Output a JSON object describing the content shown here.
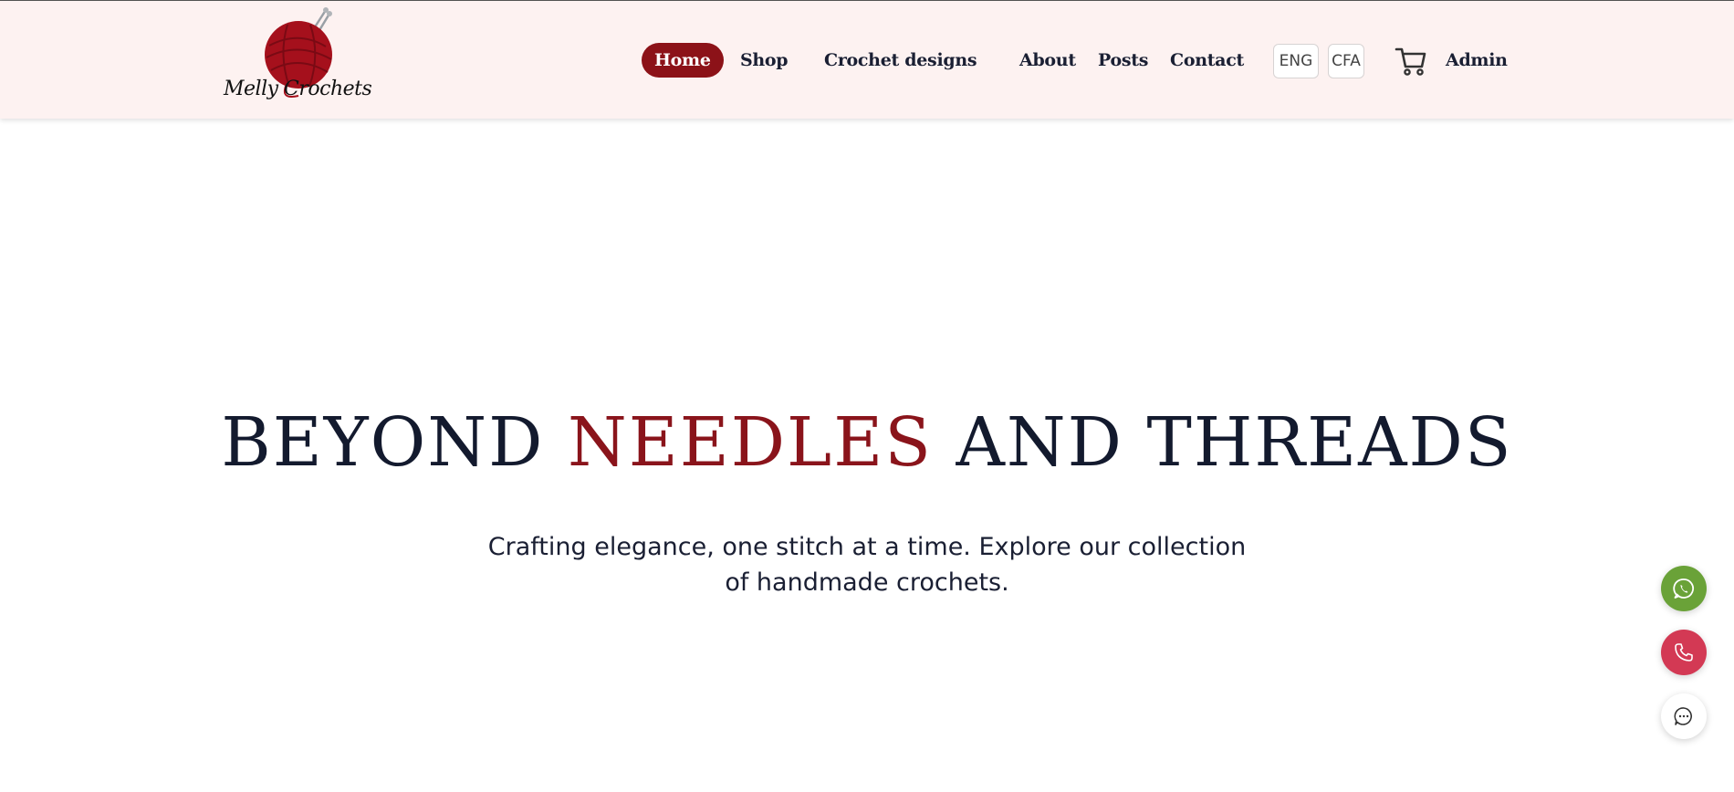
{
  "brand": {
    "logo_text": "Melly Crochets",
    "accent_color": "#8c1218",
    "header_bg": "#fdf2f1"
  },
  "nav": {
    "items": [
      {
        "label": "Home",
        "active": true
      },
      {
        "label": "Shop"
      },
      {
        "label": "Crochet designs"
      },
      {
        "label": "About"
      },
      {
        "label": "Posts"
      },
      {
        "label": "Contact"
      }
    ],
    "language": "ENG",
    "currency": "CFA",
    "cart_icon": "cart-icon",
    "admin_label": "Admin"
  },
  "hero": {
    "title_part1": "BEYOND ",
    "title_accent": "NEEDLES",
    "title_part2": " AND THREADS",
    "subtitle": "Crafting elegance, one stitch at a time. Explore our collection of handmade crochets."
  },
  "floating": {
    "whatsapp_icon": "whatsapp-icon",
    "whatsapp_color": "#6aa238",
    "phone_icon": "phone-icon",
    "phone_color": "#d33954",
    "chat_icon": "chat-icon"
  }
}
